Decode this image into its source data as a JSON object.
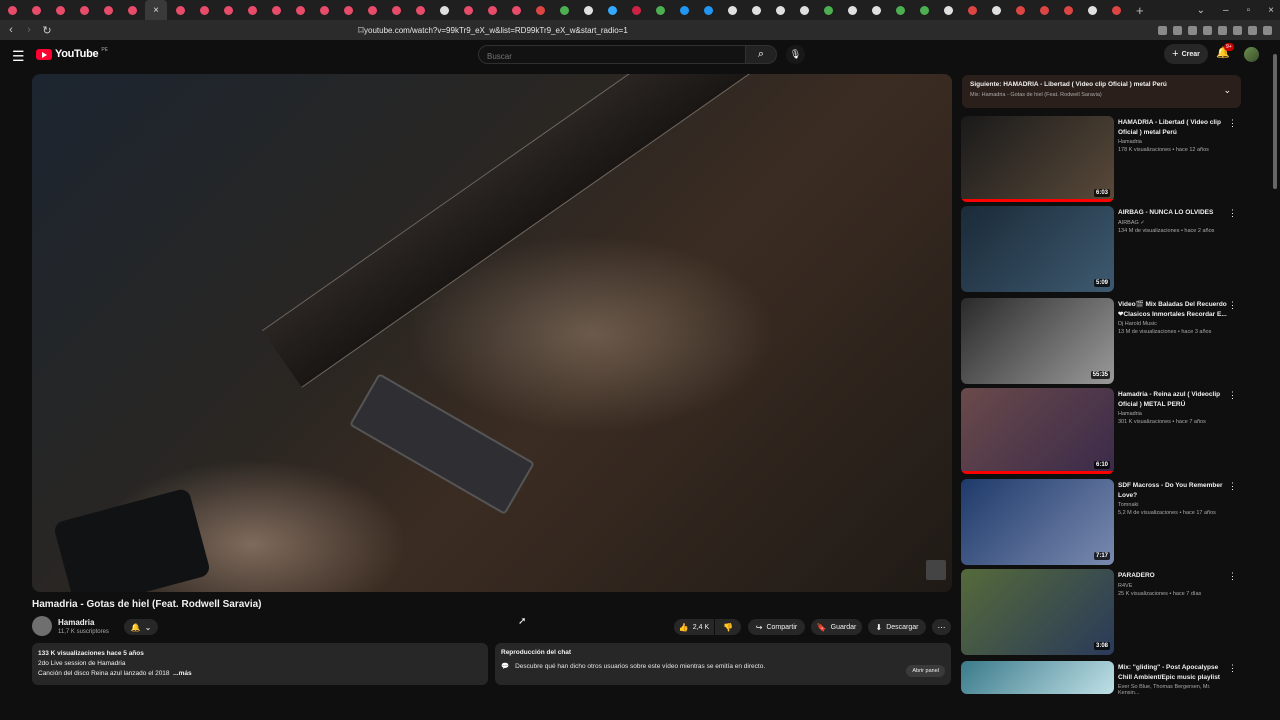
{
  "browser": {
    "tab_favicon_colors": [
      "#e94b6a",
      "#e94b6a",
      "#e94b6a",
      "#e94b6a",
      "#e94b6a",
      "#e94b6a",
      "#e94b6a",
      "#e94b6a",
      "#e94b6a",
      "#e94b6a",
      "#e94b6a",
      "#e94b6a",
      "#e94b6a",
      "#e94b6a",
      "#e94b6a",
      "#e94b6a",
      "#e94b6a",
      "#e0e0e0",
      "#e94b6a",
      "#e94b6a",
      "#e94b6a",
      "#d44",
      "#4caf50",
      "#e0e0e0",
      "#33aaff",
      "#cc2244",
      "#4caf50",
      "#2196f3",
      "#2196f3",
      "#e0e0e0",
      "#e0e0e0",
      "#e0e0e0",
      "#e0e0e0",
      "#4caf50",
      "#e0e0e0",
      "#e0e0e0",
      "#4caf50",
      "#4caf50",
      "#e0e0e0",
      "#d44",
      "#e0e0e0",
      "#d44",
      "#d44",
      "#d44",
      "#e0e0e0",
      "#d44",
      "#d44",
      "#888"
    ],
    "active_tab_glyph": "×",
    "new_tab": "+",
    "window_controls": [
      "⌄",
      "–",
      "▫",
      "×"
    ],
    "url": "youtube.com/watch?v=99kTr9_eX_w&list=RD99kTr9_eX_w&start_radio=1"
  },
  "header": {
    "logo_text": "YouTube",
    "logo_country": "PE",
    "search_placeholder": "Buscar",
    "create_label": "Crear",
    "notifications_badge": "9+"
  },
  "video": {
    "title": "Hamadria - Gotas de hiel (Feat. Rodwell Saravia)",
    "channel": "Hamadria",
    "subscribers": "11,7 K suscriptores",
    "likes": "2,4 K",
    "share_label": "Compartir",
    "save_label": "Guardar",
    "download_label": "Descargar",
    "views_line": "133 K visualizaciones  hace 5 años",
    "desc_line1": "2do Live session de Hamadria",
    "desc_line2": "Canción del disco Reina azul lanzado el 2018",
    "more_label": "...más"
  },
  "chat": {
    "title": "Reproducción del chat",
    "text": "Descubre qué han dicho otros usuarios sobre este vídeo mientras se emitía en directo.",
    "open_label": "Abrir panel"
  },
  "playlist": {
    "next": "Siguiente: HAMADRIA - Libertad ( Video clip Oficial ) metal Perú",
    "mix": "Mix: Hamadria - Gotas de hiel (Feat. Rodwell Saravia)"
  },
  "recommendations": [
    {
      "title": "HAMADRIA - Libertad ( Video clip Oficial ) metal Perú",
      "channel": "Hamadria",
      "meta": "178 K visualizaciones • hace 12 años",
      "duration": "6:03",
      "watched": 1.0,
      "colors": [
        "#1a1a1a",
        "#5a4a3a"
      ]
    },
    {
      "title": "AIRBAG - NUNCA LO OLVIDES",
      "channel": "AIRBAG ✓",
      "meta": "134 M de visualizaciones • hace 2 años",
      "duration": "5:09",
      "watched": 0,
      "colors": [
        "#1a2a38",
        "#3e5a70"
      ]
    },
    {
      "title": "Video🎬 Mix Baladas Del Recuerdo ❤Clasicos Inmortales Recordar E...",
      "channel": "Dj Harold Music",
      "meta": "13 M de visualizaciones • hace 3 años",
      "duration": "55:35",
      "watched": 0,
      "colors": [
        "#2a2a2a",
        "#9a9a9a"
      ]
    },
    {
      "title": "Hamadria - Reina azul ( Videoclip Oficial ) METAL PERÚ",
      "channel": "Hamadria",
      "meta": "301 K visualizaciones • hace 7 años",
      "duration": "6:10",
      "watched": 1.0,
      "colors": [
        "#6a4a4a",
        "#3a2a4a"
      ]
    },
    {
      "title": "SDF Macross - Do You Remember Love?",
      "channel": "Tomnaki",
      "meta": "5,2 M de visualizaciones • hace 17 años",
      "duration": "7:17",
      "watched": 0,
      "colors": [
        "#1e3a6a",
        "#7a8ab0"
      ]
    },
    {
      "title": "PARADERO",
      "channel": "R4VE",
      "meta": "25 K visualizaciones • hace 7 días",
      "duration": "3:08",
      "watched": 0,
      "colors": [
        "#556a3a",
        "#2a3a5a"
      ]
    },
    {
      "title": "Mix: \"gliding\" - Post Apocalypse Chill Ambient/Epic music playlist",
      "channel": "Ever So Blue, Thomas Bergersen, Mr. Kensin...",
      "meta": "",
      "duration": "",
      "watched": 0,
      "colors": [
        "#3a7a8a",
        "#bfe0e6"
      ]
    }
  ],
  "icons": {
    "menu": "hamburger-icon",
    "search": "search-icon",
    "mic": "mic-icon",
    "bell": "bell-icon",
    "like": "thumbs-up-icon",
    "dislike": "thumbs-down-icon",
    "share": "share-icon",
    "save": "bookmark-icon",
    "download": "download-icon",
    "more": "more-icon",
    "chat": "chat-icon"
  }
}
